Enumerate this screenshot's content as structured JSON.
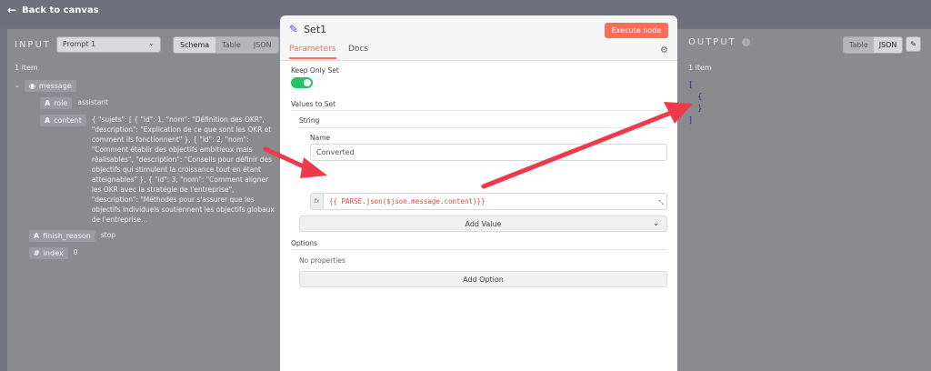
{
  "topbar": {
    "back_label": "Back to canvas"
  },
  "input_panel": {
    "title": "INPUT",
    "node_select": "Prompt 1",
    "tabs": [
      "Schema",
      "Table",
      "JSON"
    ],
    "active_tab": "Schema",
    "item_count": "1 item",
    "message_key": "message",
    "role_key": "role",
    "role_value": "assistant",
    "content_key": "content",
    "content_value": "{ \"sujets\": [ { \"id\": 1, \"nom\": \"Définition des OKR\", \"description\": \"Explication de ce que sont les OKR et comment ils fonctionnent\" }, { \"id\": 2, \"nom\": \"Comment établir des objectifs ambitieux mais réalisables\", \"description\": \"Conseils pour définir des objectifs qui stimulent la croissance tout en étant atteignables\" }, { \"id\": 3, \"nom\": \"Comment aligner les OKR avec la stratégie de l'entreprise\", \"description\": \"Méthodes pour s'assurer que les objectifs individuels soutiennent les objectifs globaux de l'entreprise...",
    "finish_key": "finish_reason",
    "finish_value": "stop",
    "index_key": "index",
    "index_value": "0"
  },
  "node": {
    "name": "Set1",
    "execute_label": "Execute node",
    "tabs": [
      "Parameters",
      "Docs"
    ],
    "active_tab": "Parameters",
    "keep_only_set_label": "Keep Only Set",
    "keep_only_set": true,
    "values_to_set_label": "Values to Set",
    "string_label": "String",
    "name_label": "Name",
    "name_value": "Converted",
    "fx_label": "fx",
    "expression": "{{ PARSE.json($json.message.content)}}",
    "add_value_label": "Add Value",
    "options_label": "Options",
    "no_properties": "No properties",
    "add_option_label": "Add Option"
  },
  "output_panel": {
    "title": "OUTPUT",
    "info_glyph": "i",
    "tabs": [
      "Table",
      "JSON"
    ],
    "active_tab": "JSON",
    "item_count": "1 item",
    "json_lines": [
      "[",
      "  {",
      "  }",
      "]"
    ]
  },
  "colors": {
    "accent": "#ff6d5a",
    "toggle_on": "#23c463",
    "expression": "#e0453f",
    "arrow": "#ef3a4b"
  }
}
